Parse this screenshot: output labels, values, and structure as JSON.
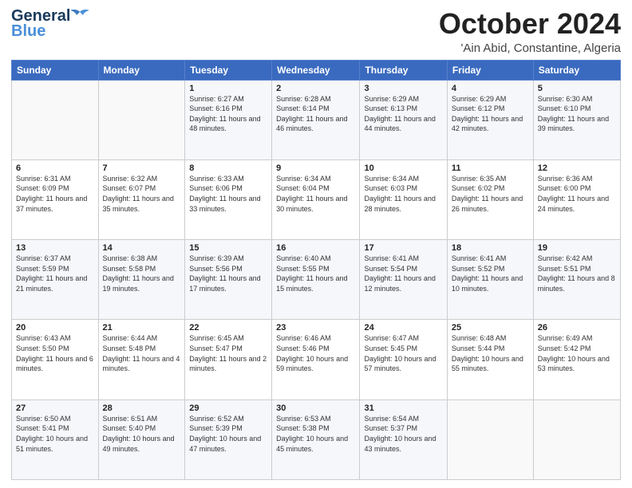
{
  "header": {
    "logo_line1": "General",
    "logo_line2": "Blue",
    "month": "October 2024",
    "location": "'Ain Abid, Constantine, Algeria"
  },
  "days_of_week": [
    "Sunday",
    "Monday",
    "Tuesday",
    "Wednesday",
    "Thursday",
    "Friday",
    "Saturday"
  ],
  "weeks": [
    [
      {
        "day": "",
        "sunrise": "",
        "sunset": "",
        "daylight": ""
      },
      {
        "day": "",
        "sunrise": "",
        "sunset": "",
        "daylight": ""
      },
      {
        "day": "1",
        "sunrise": "Sunrise: 6:27 AM",
        "sunset": "Sunset: 6:16 PM",
        "daylight": "Daylight: 11 hours and 48 minutes."
      },
      {
        "day": "2",
        "sunrise": "Sunrise: 6:28 AM",
        "sunset": "Sunset: 6:14 PM",
        "daylight": "Daylight: 11 hours and 46 minutes."
      },
      {
        "day": "3",
        "sunrise": "Sunrise: 6:29 AM",
        "sunset": "Sunset: 6:13 PM",
        "daylight": "Daylight: 11 hours and 44 minutes."
      },
      {
        "day": "4",
        "sunrise": "Sunrise: 6:29 AM",
        "sunset": "Sunset: 6:12 PM",
        "daylight": "Daylight: 11 hours and 42 minutes."
      },
      {
        "day": "5",
        "sunrise": "Sunrise: 6:30 AM",
        "sunset": "Sunset: 6:10 PM",
        "daylight": "Daylight: 11 hours and 39 minutes."
      }
    ],
    [
      {
        "day": "6",
        "sunrise": "Sunrise: 6:31 AM",
        "sunset": "Sunset: 6:09 PM",
        "daylight": "Daylight: 11 hours and 37 minutes."
      },
      {
        "day": "7",
        "sunrise": "Sunrise: 6:32 AM",
        "sunset": "Sunset: 6:07 PM",
        "daylight": "Daylight: 11 hours and 35 minutes."
      },
      {
        "day": "8",
        "sunrise": "Sunrise: 6:33 AM",
        "sunset": "Sunset: 6:06 PM",
        "daylight": "Daylight: 11 hours and 33 minutes."
      },
      {
        "day": "9",
        "sunrise": "Sunrise: 6:34 AM",
        "sunset": "Sunset: 6:04 PM",
        "daylight": "Daylight: 11 hours and 30 minutes."
      },
      {
        "day": "10",
        "sunrise": "Sunrise: 6:34 AM",
        "sunset": "Sunset: 6:03 PM",
        "daylight": "Daylight: 11 hours and 28 minutes."
      },
      {
        "day": "11",
        "sunrise": "Sunrise: 6:35 AM",
        "sunset": "Sunset: 6:02 PM",
        "daylight": "Daylight: 11 hours and 26 minutes."
      },
      {
        "day": "12",
        "sunrise": "Sunrise: 6:36 AM",
        "sunset": "Sunset: 6:00 PM",
        "daylight": "Daylight: 11 hours and 24 minutes."
      }
    ],
    [
      {
        "day": "13",
        "sunrise": "Sunrise: 6:37 AM",
        "sunset": "Sunset: 5:59 PM",
        "daylight": "Daylight: 11 hours and 21 minutes."
      },
      {
        "day": "14",
        "sunrise": "Sunrise: 6:38 AM",
        "sunset": "Sunset: 5:58 PM",
        "daylight": "Daylight: 11 hours and 19 minutes."
      },
      {
        "day": "15",
        "sunrise": "Sunrise: 6:39 AM",
        "sunset": "Sunset: 5:56 PM",
        "daylight": "Daylight: 11 hours and 17 minutes."
      },
      {
        "day": "16",
        "sunrise": "Sunrise: 6:40 AM",
        "sunset": "Sunset: 5:55 PM",
        "daylight": "Daylight: 11 hours and 15 minutes."
      },
      {
        "day": "17",
        "sunrise": "Sunrise: 6:41 AM",
        "sunset": "Sunset: 5:54 PM",
        "daylight": "Daylight: 11 hours and 12 minutes."
      },
      {
        "day": "18",
        "sunrise": "Sunrise: 6:41 AM",
        "sunset": "Sunset: 5:52 PM",
        "daylight": "Daylight: 11 hours and 10 minutes."
      },
      {
        "day": "19",
        "sunrise": "Sunrise: 6:42 AM",
        "sunset": "Sunset: 5:51 PM",
        "daylight": "Daylight: 11 hours and 8 minutes."
      }
    ],
    [
      {
        "day": "20",
        "sunrise": "Sunrise: 6:43 AM",
        "sunset": "Sunset: 5:50 PM",
        "daylight": "Daylight: 11 hours and 6 minutes."
      },
      {
        "day": "21",
        "sunrise": "Sunrise: 6:44 AM",
        "sunset": "Sunset: 5:48 PM",
        "daylight": "Daylight: 11 hours and 4 minutes."
      },
      {
        "day": "22",
        "sunrise": "Sunrise: 6:45 AM",
        "sunset": "Sunset: 5:47 PM",
        "daylight": "Daylight: 11 hours and 2 minutes."
      },
      {
        "day": "23",
        "sunrise": "Sunrise: 6:46 AM",
        "sunset": "Sunset: 5:46 PM",
        "daylight": "Daylight: 10 hours and 59 minutes."
      },
      {
        "day": "24",
        "sunrise": "Sunrise: 6:47 AM",
        "sunset": "Sunset: 5:45 PM",
        "daylight": "Daylight: 10 hours and 57 minutes."
      },
      {
        "day": "25",
        "sunrise": "Sunrise: 6:48 AM",
        "sunset": "Sunset: 5:44 PM",
        "daylight": "Daylight: 10 hours and 55 minutes."
      },
      {
        "day": "26",
        "sunrise": "Sunrise: 6:49 AM",
        "sunset": "Sunset: 5:42 PM",
        "daylight": "Daylight: 10 hours and 53 minutes."
      }
    ],
    [
      {
        "day": "27",
        "sunrise": "Sunrise: 6:50 AM",
        "sunset": "Sunset: 5:41 PM",
        "daylight": "Daylight: 10 hours and 51 minutes."
      },
      {
        "day": "28",
        "sunrise": "Sunrise: 6:51 AM",
        "sunset": "Sunset: 5:40 PM",
        "daylight": "Daylight: 10 hours and 49 minutes."
      },
      {
        "day": "29",
        "sunrise": "Sunrise: 6:52 AM",
        "sunset": "Sunset: 5:39 PM",
        "daylight": "Daylight: 10 hours and 47 minutes."
      },
      {
        "day": "30",
        "sunrise": "Sunrise: 6:53 AM",
        "sunset": "Sunset: 5:38 PM",
        "daylight": "Daylight: 10 hours and 45 minutes."
      },
      {
        "day": "31",
        "sunrise": "Sunrise: 6:54 AM",
        "sunset": "Sunset: 5:37 PM",
        "daylight": "Daylight: 10 hours and 43 minutes."
      },
      {
        "day": "",
        "sunrise": "",
        "sunset": "",
        "daylight": ""
      },
      {
        "day": "",
        "sunrise": "",
        "sunset": "",
        "daylight": ""
      }
    ]
  ]
}
